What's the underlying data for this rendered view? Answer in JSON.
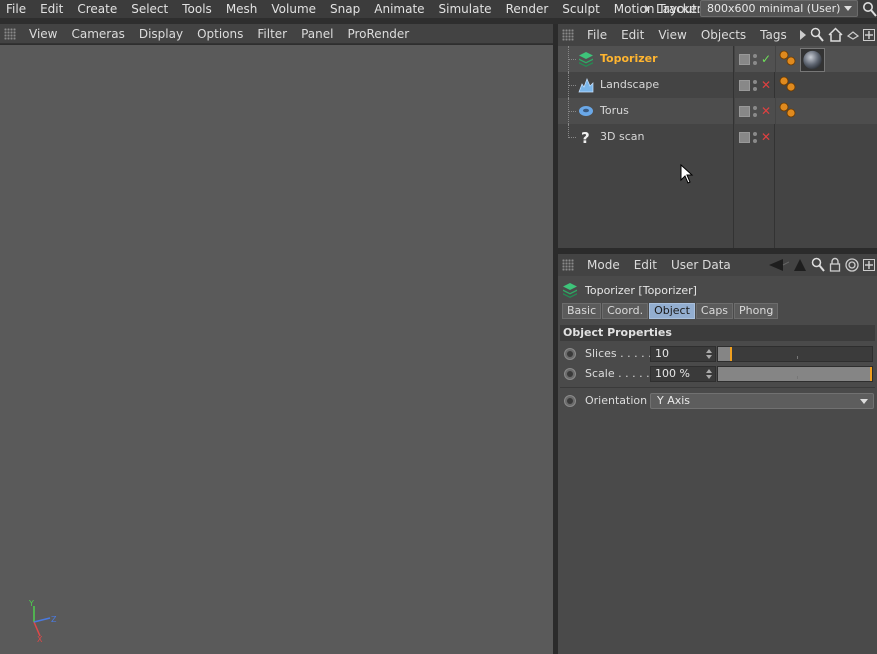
{
  "menubar": {
    "items": [
      "File",
      "Edit",
      "Create",
      "Select",
      "Tools",
      "Mesh",
      "Volume",
      "Snap",
      "Animate",
      "Simulate",
      "Render",
      "Sculpt",
      "Motion Tracker"
    ],
    "layout_label": "Layout:",
    "layout_value": "800x600 minimal (User)"
  },
  "viewport": {
    "menu": [
      "View",
      "Cameras",
      "Display",
      "Options",
      "Filter",
      "Panel",
      "ProRender"
    ],
    "axis_labels": {
      "y": "Y",
      "z": "Z",
      "x": "X"
    }
  },
  "object_manager": {
    "menu": [
      "File",
      "Edit",
      "View",
      "Objects",
      "Tags"
    ],
    "objects": [
      {
        "name": "Toporizer",
        "icon": "toporizer-icon",
        "active": true,
        "status": "✓",
        "status_kind": "ok",
        "tags": [
          "phong-tag",
          "material-tag"
        ]
      },
      {
        "name": "Landscape",
        "icon": "landscape-icon",
        "active": false,
        "status": "✕",
        "status_kind": "no",
        "tags": [
          "phong-tag"
        ]
      },
      {
        "name": "Torus",
        "icon": "torus-icon",
        "active": false,
        "status": "✕",
        "status_kind": "no",
        "tags": [
          "phong-tag"
        ]
      },
      {
        "name": "3D scan",
        "icon": "unknown-object-icon",
        "active": false,
        "status": "✕",
        "status_kind": "no",
        "tags": []
      }
    ]
  },
  "attribute_manager": {
    "menu": [
      "Mode",
      "Edit",
      "User Data"
    ],
    "title": "Toporizer [Toporizer]",
    "tabs": [
      "Basic",
      "Coord.",
      "Object",
      "Caps",
      "Phong"
    ],
    "active_tab": "Object",
    "section": "Object Properties",
    "slices": {
      "label": "Slices . . . . .",
      "value": "10",
      "fraction": 0.09
    },
    "scale": {
      "label": "Scale . . . . .",
      "value": "100 %",
      "fraction": 1.0
    },
    "orientation": {
      "label": "Orientation",
      "value": "Y Axis"
    }
  },
  "colors": {
    "accent_orange": "#ffb530",
    "tab_active": "#93aed0",
    "check_green": "#6fe05a",
    "cross_red": "#e04040"
  }
}
